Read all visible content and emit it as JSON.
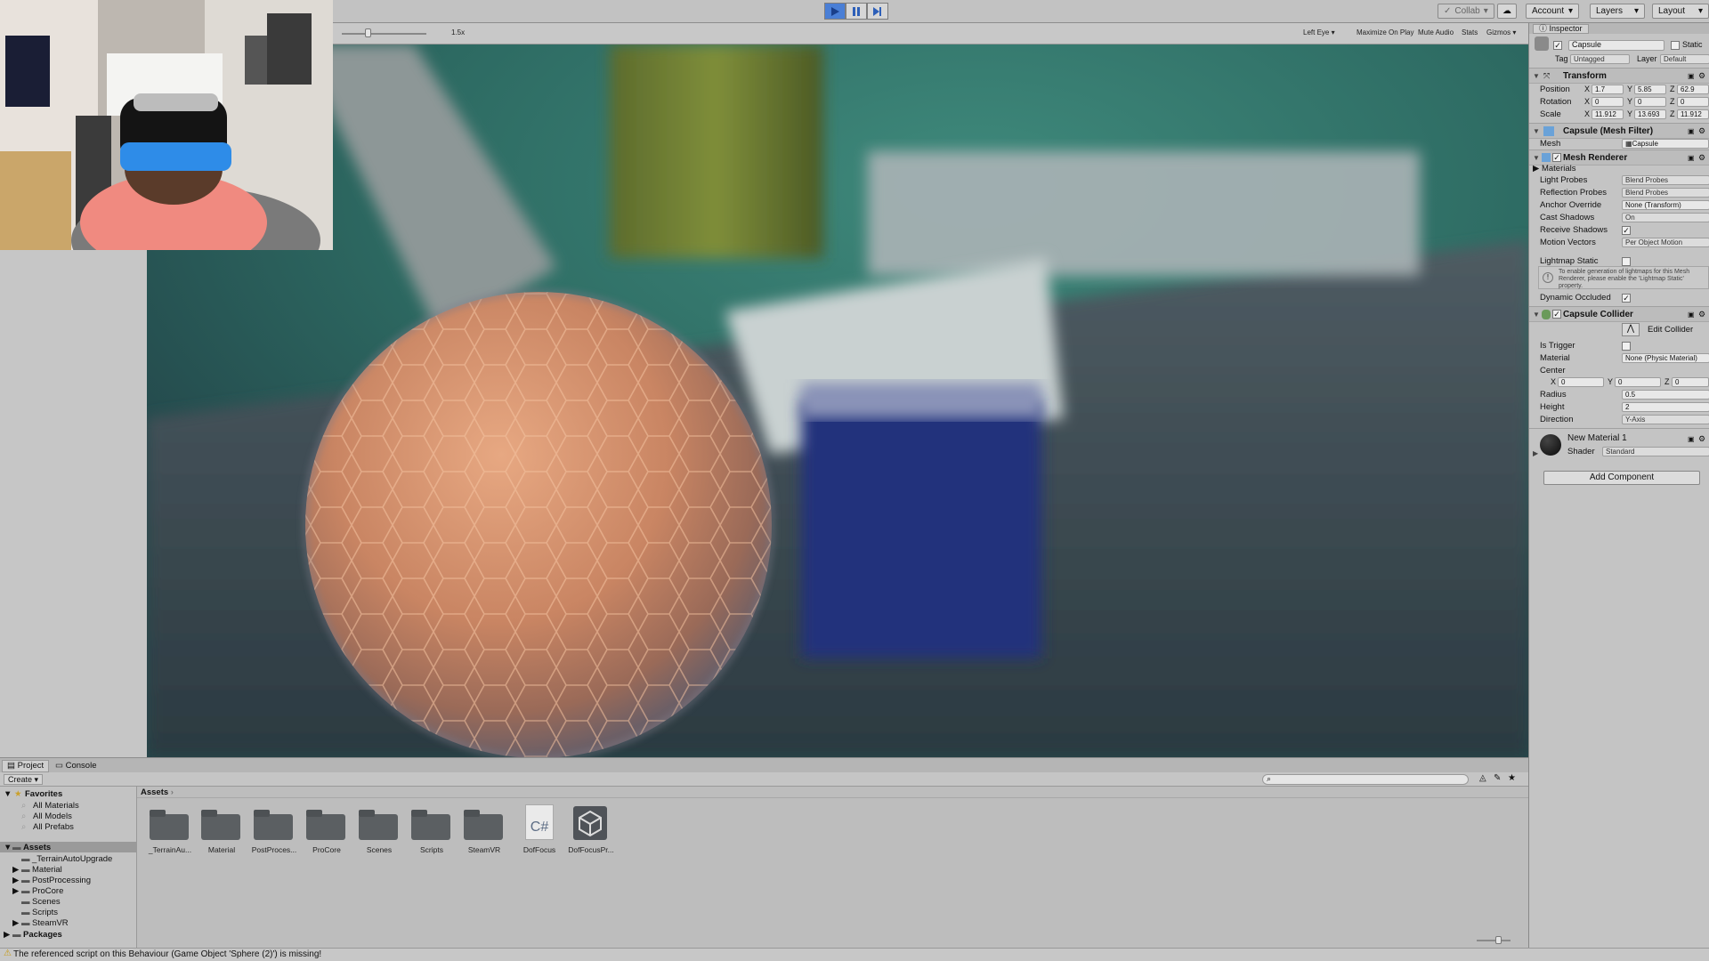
{
  "toolbar": {
    "collab_label": "Collab",
    "account_label": "Account",
    "layers_label": "Layers",
    "layout_label": "Layout"
  },
  "gameview": {
    "scale_label": "1.5x",
    "display_label": "Left Eye",
    "maximize_label": "Maximize On Play",
    "mute_label": "Mute Audio",
    "stats_label": "Stats",
    "gizmos_label": "Gizmos"
  },
  "inspector": {
    "tab_label": "Inspector",
    "object_name": "Capsule",
    "static_label": "Static",
    "tag_label": "Tag",
    "tag_value": "Untagged",
    "layer_label": "Layer",
    "layer_value": "Default",
    "transform": {
      "title": "Transform",
      "position_label": "Position",
      "rotation_label": "Rotation",
      "scale_label": "Scale",
      "position": {
        "x": "1.7",
        "y": "5.85",
        "z": "62.9"
      },
      "rotation": {
        "x": "0",
        "y": "0",
        "z": "0"
      },
      "scale": {
        "x": "11.912",
        "y": "13.693",
        "z": "11.912"
      }
    },
    "mesh_filter": {
      "title": "Capsule (Mesh Filter)",
      "mesh_label": "Mesh",
      "mesh_value": "Capsule"
    },
    "mesh_renderer": {
      "title": "Mesh Renderer",
      "materials_label": "Materials",
      "light_probes_label": "Light Probes",
      "light_probes_value": "Blend Probes",
      "reflection_probes_label": "Reflection Probes",
      "reflection_probes_value": "Blend Probes",
      "anchor_label": "Anchor Override",
      "anchor_value": "None (Transform)",
      "cast_shadows_label": "Cast Shadows",
      "cast_shadows_value": "On",
      "receive_shadows_label": "Receive Shadows",
      "motion_vectors_label": "Motion Vectors",
      "motion_vectors_value": "Per Object Motion",
      "lightmap_static_label": "Lightmap Static",
      "info_text": "To enable generation of lightmaps for this Mesh Renderer, please enable the 'Lightmap Static' property.",
      "dynamic_occluded_label": "Dynamic Occluded"
    },
    "capsule_collider": {
      "title": "Capsule Collider",
      "edit_label": "Edit Collider",
      "is_trigger_label": "Is Trigger",
      "material_label": "Material",
      "material_value": "None (Physic Material)",
      "center_label": "Center",
      "center": {
        "x": "0",
        "y": "0",
        "z": "0"
      },
      "radius_label": "Radius",
      "radius_value": "0.5",
      "height_label": "Height",
      "height_value": "2",
      "direction_label": "Direction",
      "direction_value": "Y-Axis"
    },
    "material": {
      "name": "New Material 1",
      "shader_label": "Shader",
      "shader_value": "Standard"
    },
    "add_component_label": "Add Component"
  },
  "project": {
    "tab_project": "Project",
    "tab_console": "Console",
    "create_label": "Create",
    "favorites_label": "Favorites",
    "favorites": [
      "All Materials",
      "All Models",
      "All Prefabs"
    ],
    "assets_label": "Assets",
    "folders": [
      "_TerrainAutoUpgrade",
      "Material",
      "PostProcessing",
      "ProCore",
      "Scenes",
      "Scripts",
      "SteamVR"
    ],
    "packages_label": "Packages",
    "breadcrumb": "Assets",
    "asset_items": [
      "_TerrainAu...",
      "Material",
      "PostProces...",
      "ProCore",
      "Scenes",
      "Scripts",
      "SteamVR",
      "DofFocus",
      "DofFocusPr..."
    ],
    "script_glyph": "C#"
  },
  "status": {
    "message": "The referenced script on this Behaviour (Game Object 'Sphere (2)') is missing!"
  }
}
